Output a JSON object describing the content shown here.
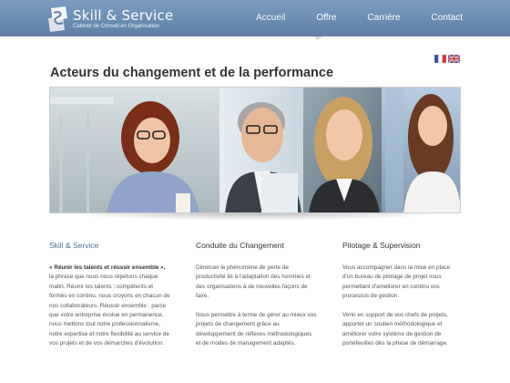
{
  "header": {
    "logo_title": "Skill & Service",
    "logo_subtitle": "Cabinet de Conseil en Organisation",
    "nav": [
      "Accueil",
      "Offre",
      "Carrière",
      "Contact"
    ],
    "colors": {
      "bar_top": "#7c9bbf",
      "bar_bottom": "#5f80a6"
    }
  },
  "languages": [
    {
      "icon": "flag-france-icon"
    },
    {
      "icon": "flag-uk-icon"
    }
  ],
  "page_title": "Acteurs du changement et de la performance",
  "columns": [
    {
      "title": "Skill & Service",
      "intro_bold": "« Réunir les talents et réussir ensemble »,",
      "intro_rest": " la phrase que nous nous répétons chaque matin. Réunir les talents : compétents et formés en continu, nous croyons en chacun de nos collaborateurs. Réussir ensemble : parce que votre entreprise évolue en permanence, nous mettons tout notre professionnalisme, notre expertise et notre flexibilité au service de vos projets et de vos démarches d'évolution."
    },
    {
      "title": "Conduite du Changement",
      "p1": "Diminuer le phénomène de perte de productivité lié à l'adaptation des hommes et des organisations à de nouvelles façons de faire.",
      "p2": "Nous permettre à terme de gérer au mieux vos projets de changement grâce au développement de réflexes méthodologiques et de modes de management adaptés."
    },
    {
      "title": "Pilotage & Supervision",
      "p1": "Vous accompagner dans la mise en place d'un bureau de pilotage de projet vous permettant d'améliorer en continu vos processus de gestion.",
      "p2": "Venir en support de vos chefs de projets, apporter un soutien méthodologique et améliorer votre système de gestion de portefeuilles dès la phase de démarrage."
    }
  ]
}
